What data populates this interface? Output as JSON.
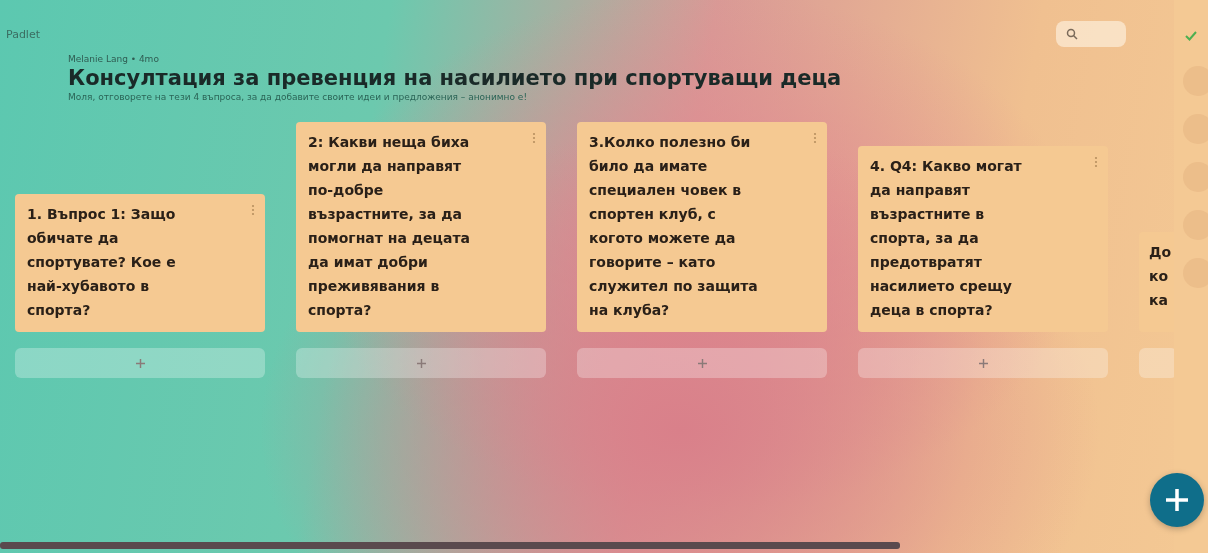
{
  "app": {
    "logo": "Padlet"
  },
  "board": {
    "author": "Melanie Lang • 4mo",
    "title": "Консултация за превенция на насилието при спортуващи деца",
    "subtitle": "Моля, отговорете на тези 4 въпроса, за да добавите своите идеи и предложения – анонимно е!"
  },
  "columns": [
    {
      "title": "1. Въпрос 1: Защо обичате да спортувате? Кое е най-хубавото в спорта?"
    },
    {
      "title": "2: Какви неща биха могли да направят по-добре възрастните, за да помогнат на децата да имат добри преживявания в спорта?"
    },
    {
      "title": "3.Колко полезно би било да имате специален човек в спортен клуб, с когото можете да говорите – като служител по защита на клуба?"
    },
    {
      "title": "4. Q4: Какво могат да направят възрастните в спорта, за да предотвратят насилието срещу деца в спорта?"
    },
    {
      "title_lines": [
        "До",
        "ко",
        "ка"
      ]
    }
  ]
}
